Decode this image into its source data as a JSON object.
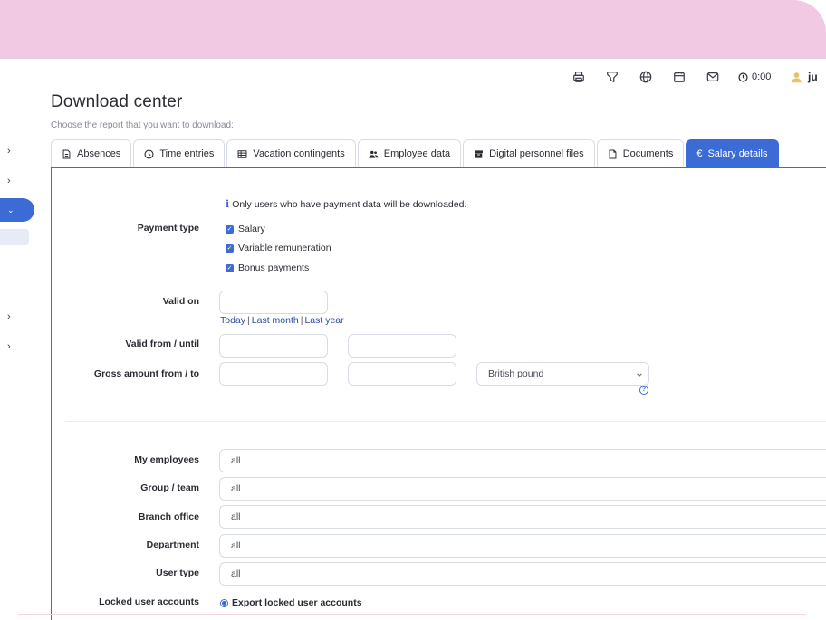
{
  "toolbar": {
    "icons": [
      "print-icon",
      "filter-icon",
      "globe-icon",
      "calendar-icon",
      "mail-icon"
    ],
    "timer": "0:00",
    "user_initial": "ju"
  },
  "page": {
    "title": "Download center",
    "subtitle": "Choose the report that you want to download:"
  },
  "tabs": [
    {
      "label": "Absences",
      "icon": "document-icon"
    },
    {
      "label": "Time entries",
      "icon": "clock-icon"
    },
    {
      "label": "Vacation contingents",
      "icon": "table-icon"
    },
    {
      "label": "Employee data",
      "icon": "users-icon"
    },
    {
      "label": "Digital personnel files",
      "icon": "archive-icon"
    },
    {
      "label": "Documents",
      "icon": "file-icon"
    },
    {
      "label": "Salary details",
      "icon": "euro-icon",
      "active": true
    }
  ],
  "form": {
    "info": "Only users who have payment data will be downloaded.",
    "payment_type_label": "Payment type",
    "payment_types": [
      "Salary",
      "Variable remuneration",
      "Bonus payments"
    ],
    "valid_on_label": "Valid on",
    "quick_links": [
      "Today",
      "Last month",
      "Last year"
    ],
    "valid_range_label": "Valid from / until",
    "gross_label": "Gross amount from / to",
    "currency": "British pound",
    "filters": [
      {
        "label": "My employees",
        "value": "all"
      },
      {
        "label": "Group / team",
        "value": "all"
      },
      {
        "label": "Branch office",
        "value": "all"
      },
      {
        "label": "Department",
        "value": "all"
      },
      {
        "label": "User type",
        "value": "all"
      }
    ],
    "locked_label": "Locked user accounts",
    "locked_option": "Export locked user accounts"
  },
  "colors": {
    "accent": "#3d6bd6",
    "top_band": "#f1c9e2",
    "link": "#2c4c9e"
  }
}
